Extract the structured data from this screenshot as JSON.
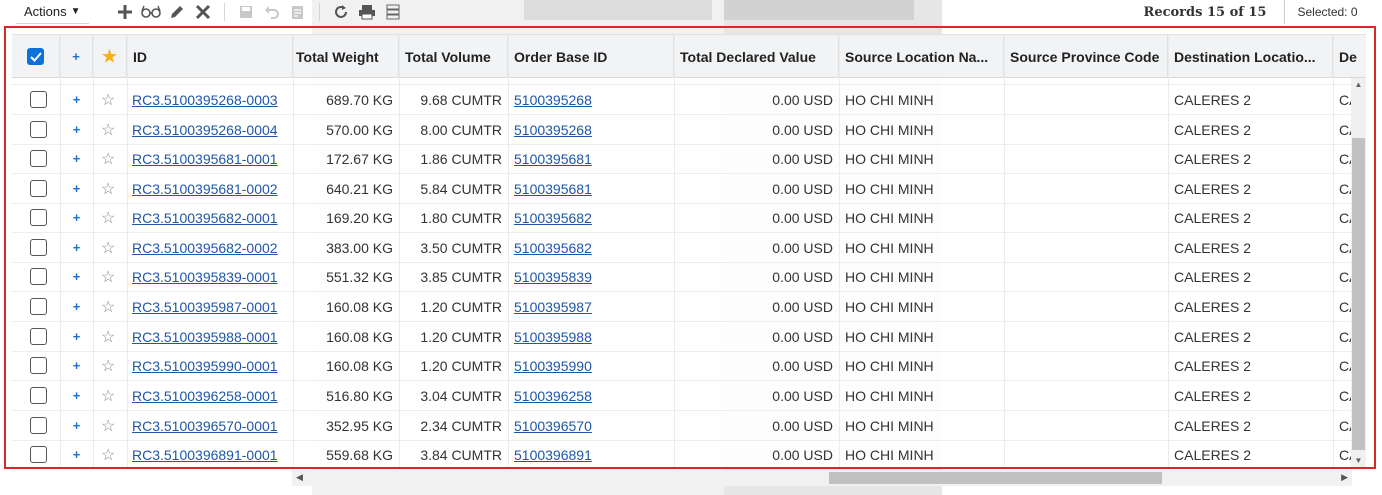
{
  "toolbar": {
    "actions_label": "Actions",
    "records_text": "Records 15 of 15",
    "selected_text": "Selected: 0",
    "icons": [
      "add-icon",
      "glasses-icon",
      "edit-icon",
      "delete-icon",
      "save-icon",
      "undo-icon",
      "note-icon",
      "refresh-icon",
      "print-icon",
      "list-icon"
    ]
  },
  "table": {
    "columns": [
      "ID",
      "Total Weight",
      "Total Volume",
      "Order Base ID",
      "Total Declared Value",
      "Source Location Na...",
      "Source Province Code",
      "Destination Locatio...",
      "De"
    ],
    "header_plus": "+",
    "rows": [
      {
        "id": "RC3.5100395268-0003",
        "weight": "689.70 KG",
        "volume": "9.68 CUMTR",
        "order": "5100395268",
        "value": "0.00 USD",
        "source": "HO CHI MINH",
        "province": "",
        "dest": "CALERES 2",
        "de": "CA"
      },
      {
        "id": "RC3.5100395268-0004",
        "weight": "570.00 KG",
        "volume": "8.00 CUMTR",
        "order": "5100395268",
        "value": "0.00 USD",
        "source": "HO CHI MINH",
        "province": "",
        "dest": "CALERES 2",
        "de": "CA"
      },
      {
        "id": "RC3.5100395681-0001",
        "weight": "172.67 KG",
        "volume": "1.86 CUMTR",
        "order": "5100395681",
        "value": "0.00 USD",
        "source": "HO CHI MINH",
        "province": "",
        "dest": "CALERES 2",
        "de": "CA"
      },
      {
        "id": "RC3.5100395681-0002",
        "weight": "640.21 KG",
        "volume": "5.84 CUMTR",
        "order": "5100395681",
        "value": "0.00 USD",
        "source": "HO CHI MINH",
        "province": "",
        "dest": "CALERES 2",
        "de": "CA"
      },
      {
        "id": "RC3.5100395682-0001",
        "weight": "169.20 KG",
        "volume": "1.80 CUMTR",
        "order": "5100395682",
        "value": "0.00 USD",
        "source": "HO CHI MINH",
        "province": "",
        "dest": "CALERES 2",
        "de": "CA"
      },
      {
        "id": "RC3.5100395682-0002",
        "weight": "383.00 KG",
        "volume": "3.50 CUMTR",
        "order": "5100395682",
        "value": "0.00 USD",
        "source": "HO CHI MINH",
        "province": "",
        "dest": "CALERES 2",
        "de": "CA"
      },
      {
        "id": "RC3.5100395839-0001",
        "weight": "551.32 KG",
        "volume": "3.85 CUMTR",
        "order": "5100395839",
        "value": "0.00 USD",
        "source": "HO CHI MINH",
        "province": "",
        "dest": "CALERES 2",
        "de": "CA"
      },
      {
        "id": "RC3.5100395987-0001",
        "weight": "160.08 KG",
        "volume": "1.20 CUMTR",
        "order": "5100395987",
        "value": "0.00 USD",
        "source": "HO CHI MINH",
        "province": "",
        "dest": "CALERES 2",
        "de": "CA"
      },
      {
        "id": "RC3.5100395988-0001",
        "weight": "160.08 KG",
        "volume": "1.20 CUMTR",
        "order": "5100395988",
        "value": "0.00 USD",
        "source": "HO CHI MINH",
        "province": "",
        "dest": "CALERES 2",
        "de": "CA"
      },
      {
        "id": "RC3.5100395990-0001",
        "weight": "160.08 KG",
        "volume": "1.20 CUMTR",
        "order": "5100395990",
        "value": "0.00 USD",
        "source": "HO CHI MINH",
        "province": "",
        "dest": "CALERES 2",
        "de": "CA"
      },
      {
        "id": "RC3.5100396258-0001",
        "weight": "516.80 KG",
        "volume": "3.04 CUMTR",
        "order": "5100396258",
        "value": "0.00 USD",
        "source": "HO CHI MINH",
        "province": "",
        "dest": "CALERES 2",
        "de": "CA"
      },
      {
        "id": "RC3.5100396570-0001",
        "weight": "352.95 KG",
        "volume": "2.34 CUMTR",
        "order": "5100396570",
        "value": "0.00 USD",
        "source": "HO CHI MINH",
        "province": "",
        "dest": "CALERES 2",
        "de": "CA"
      },
      {
        "id": "RC3.5100396891-0001",
        "weight": "559.68 KG",
        "volume": "3.84 CUMTR",
        "order": "5100396891",
        "value": "0.00 USD",
        "source": "HO CHI MINH",
        "province": "",
        "dest": "CALERES 2",
        "de": "CA"
      }
    ]
  },
  "colors": {
    "frame": "#d9262b",
    "link": "#1f57a8",
    "checkbox": "#0b72d9",
    "star": "#f3b21a",
    "plus": "#1e6fd0"
  }
}
